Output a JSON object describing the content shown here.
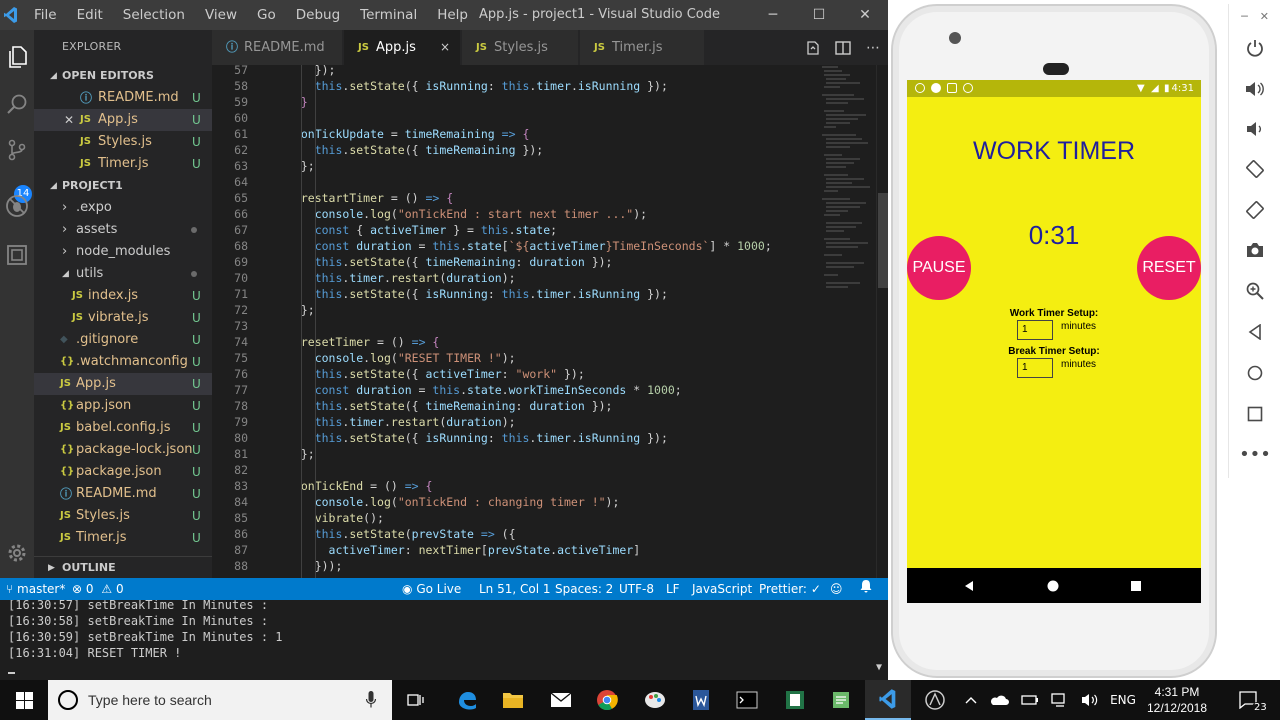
{
  "vscode": {
    "window_title": "App.js - project1 - Visual Studio Code",
    "menu": [
      "File",
      "Edit",
      "Selection",
      "View",
      "Go",
      "Debug",
      "Terminal",
      "Help"
    ],
    "explorer_title": "EXPLORER",
    "scm_badge": "14",
    "open_editors_title": "OPEN EDITORS",
    "open_editors": [
      {
        "name": "README.md",
        "icon": "info-icon",
        "status": "U"
      },
      {
        "name": "App.js",
        "icon": "js-icon",
        "status": "U"
      },
      {
        "name": "Styles.js",
        "icon": "js-icon",
        "status": "U"
      },
      {
        "name": "Timer.js",
        "icon": "js-icon",
        "status": "U"
      }
    ],
    "project_title": "PROJECT1",
    "tree": [
      {
        "name": ".expo",
        "type": "folder",
        "status": ""
      },
      {
        "name": "assets",
        "type": "folder",
        "status": "dot"
      },
      {
        "name": "node_modules",
        "type": "folder",
        "status": ""
      },
      {
        "name": "utils",
        "type": "folder-open",
        "status": "dot"
      },
      {
        "name": "index.js",
        "type": "js",
        "status": "U"
      },
      {
        "name": "vibrate.js",
        "type": "js",
        "status": "U"
      },
      {
        "name": ".gitignore",
        "type": "git",
        "status": "U"
      },
      {
        "name": ".watchmanconfig",
        "type": "json",
        "status": "U"
      },
      {
        "name": "App.js",
        "type": "js",
        "status": "U"
      },
      {
        "name": "app.json",
        "type": "json",
        "status": "U"
      },
      {
        "name": "babel.config.js",
        "type": "js",
        "status": "U"
      },
      {
        "name": "package-lock.json",
        "type": "json",
        "status": "U"
      },
      {
        "name": "package.json",
        "type": "json",
        "status": "U"
      },
      {
        "name": "README.md",
        "type": "info",
        "status": "U"
      },
      {
        "name": "Styles.js",
        "type": "js",
        "status": "U"
      },
      {
        "name": "Timer.js",
        "type": "js",
        "status": "U"
      }
    ],
    "outline_title": "OUTLINE",
    "tabs": [
      {
        "name": "README.md",
        "icon": "info-icon"
      },
      {
        "name": "App.js",
        "icon": "js-icon"
      },
      {
        "name": "Styles.js",
        "icon": "js-icon"
      },
      {
        "name": "Timer.js",
        "icon": "js-icon"
      }
    ],
    "js_badge": "JS",
    "json_badge": "{}",
    "close_glyph": "×",
    "modified_glyph": "U",
    "code_lines": [
      {
        "n": "57",
        "tokens": [
          [
            "op",
            "    });"
          ]
        ]
      },
      {
        "n": "58",
        "tokens": [
          [
            "th",
            "    this"
          ],
          [
            "op",
            "."
          ],
          [
            "fn",
            "setState"
          ],
          [
            "op",
            "({ "
          ],
          [
            "vr",
            "isRunning"
          ],
          [
            "op",
            ": "
          ],
          [
            "th",
            "this"
          ],
          [
            "op",
            "."
          ],
          [
            "vr",
            "timer"
          ],
          [
            "op",
            "."
          ],
          [
            "vr",
            "isRunning"
          ],
          [
            "op",
            " });"
          ]
        ]
      },
      {
        "n": "59",
        "tokens": [
          [
            "kw2",
            "  }"
          ]
        ]
      },
      {
        "n": "60",
        "tokens": []
      },
      {
        "n": "61",
        "tokens": [
          [
            "vr",
            "  onTickUpdate"
          ],
          [
            "op",
            " = "
          ],
          [
            "vr",
            "timeRemaining"
          ],
          [
            "kw",
            " =>"
          ],
          [
            "kw2",
            " {"
          ]
        ]
      },
      {
        "n": "62",
        "tokens": [
          [
            "th",
            "    this"
          ],
          [
            "op",
            "."
          ],
          [
            "fn",
            "setState"
          ],
          [
            "op",
            "({ "
          ],
          [
            "vr",
            "timeRemaining"
          ],
          [
            "op",
            " });"
          ]
        ]
      },
      {
        "n": "63",
        "tokens": [
          [
            "op",
            "  };"
          ]
        ]
      },
      {
        "n": "64",
        "tokens": []
      },
      {
        "n": "65",
        "tokens": [
          [
            "fn",
            "  restartTimer"
          ],
          [
            "op",
            " = () "
          ],
          [
            "kw",
            "=>"
          ],
          [
            "kw2",
            " {"
          ]
        ]
      },
      {
        "n": "66",
        "tokens": [
          [
            "vr",
            "    console"
          ],
          [
            "op",
            "."
          ],
          [
            "fn",
            "log"
          ],
          [
            "op",
            "("
          ],
          [
            "str",
            "\"onTickEnd : start next timer ...\""
          ],
          [
            "op",
            ");"
          ]
        ]
      },
      {
        "n": "67",
        "tokens": [
          [
            "kw",
            "    const"
          ],
          [
            "op",
            " { "
          ],
          [
            "vr",
            "activeTimer"
          ],
          [
            "op",
            " } = "
          ],
          [
            "th",
            "this"
          ],
          [
            "op",
            "."
          ],
          [
            "vr",
            "state"
          ],
          [
            "op",
            ";"
          ]
        ]
      },
      {
        "n": "68",
        "tokens": [
          [
            "kw",
            "    const"
          ],
          [
            "vr",
            " duration"
          ],
          [
            "op",
            " = "
          ],
          [
            "th",
            "this"
          ],
          [
            "op",
            "."
          ],
          [
            "vr",
            "state"
          ],
          [
            "op",
            "["
          ],
          [
            "str",
            "`${"
          ],
          [
            "vr",
            "activeTimer"
          ],
          [
            "str",
            "}TimeInSeconds`"
          ],
          [
            "op",
            "] * "
          ],
          [
            "num",
            "1000"
          ],
          [
            "op",
            ";"
          ]
        ]
      },
      {
        "n": "69",
        "tokens": [
          [
            "th",
            "    this"
          ],
          [
            "op",
            "."
          ],
          [
            "fn",
            "setState"
          ],
          [
            "op",
            "({ "
          ],
          [
            "vr",
            "timeRemaining"
          ],
          [
            "op",
            ": "
          ],
          [
            "vr",
            "duration"
          ],
          [
            "op",
            " });"
          ]
        ]
      },
      {
        "n": "70",
        "tokens": [
          [
            "th",
            "    this"
          ],
          [
            "op",
            "."
          ],
          [
            "vr",
            "timer"
          ],
          [
            "op",
            "."
          ],
          [
            "fn",
            "restart"
          ],
          [
            "op",
            "("
          ],
          [
            "vr",
            "duration"
          ],
          [
            "op",
            ");"
          ]
        ]
      },
      {
        "n": "71",
        "tokens": [
          [
            "th",
            "    this"
          ],
          [
            "op",
            "."
          ],
          [
            "fn",
            "setState"
          ],
          [
            "op",
            "({ "
          ],
          [
            "vr",
            "isRunning"
          ],
          [
            "op",
            ": "
          ],
          [
            "th",
            "this"
          ],
          [
            "op",
            "."
          ],
          [
            "vr",
            "timer"
          ],
          [
            "op",
            "."
          ],
          [
            "vr",
            "isRunning"
          ],
          [
            "op",
            " });"
          ]
        ]
      },
      {
        "n": "72",
        "tokens": [
          [
            "op",
            "  };"
          ]
        ]
      },
      {
        "n": "73",
        "tokens": []
      },
      {
        "n": "74",
        "tokens": [
          [
            "fn",
            "  resetTimer"
          ],
          [
            "op",
            " = () "
          ],
          [
            "kw",
            "=>"
          ],
          [
            "kw2",
            " {"
          ]
        ]
      },
      {
        "n": "75",
        "tokens": [
          [
            "vr",
            "    console"
          ],
          [
            "op",
            "."
          ],
          [
            "fn",
            "log"
          ],
          [
            "op",
            "("
          ],
          [
            "str",
            "\"RESET TIMER !\""
          ],
          [
            "op",
            ");"
          ]
        ]
      },
      {
        "n": "76",
        "tokens": [
          [
            "th",
            "    this"
          ],
          [
            "op",
            "."
          ],
          [
            "fn",
            "setState"
          ],
          [
            "op",
            "({ "
          ],
          [
            "vr",
            "activeTimer"
          ],
          [
            "op",
            ": "
          ],
          [
            "str",
            "\"work\""
          ],
          [
            "op",
            " });"
          ]
        ]
      },
      {
        "n": "77",
        "tokens": [
          [
            "kw",
            "    const"
          ],
          [
            "vr",
            " duration"
          ],
          [
            "op",
            " = "
          ],
          [
            "th",
            "this"
          ],
          [
            "op",
            "."
          ],
          [
            "vr",
            "state"
          ],
          [
            "op",
            "."
          ],
          [
            "vr",
            "workTimeInSeconds"
          ],
          [
            "op",
            " * "
          ],
          [
            "num",
            "1000"
          ],
          [
            "op",
            ";"
          ]
        ]
      },
      {
        "n": "78",
        "tokens": [
          [
            "th",
            "    this"
          ],
          [
            "op",
            "."
          ],
          [
            "fn",
            "setState"
          ],
          [
            "op",
            "({ "
          ],
          [
            "vr",
            "timeRemaining"
          ],
          [
            "op",
            ": "
          ],
          [
            "vr",
            "duration"
          ],
          [
            "op",
            " });"
          ]
        ]
      },
      {
        "n": "79",
        "tokens": [
          [
            "th",
            "    this"
          ],
          [
            "op",
            "."
          ],
          [
            "vr",
            "timer"
          ],
          [
            "op",
            "."
          ],
          [
            "fn",
            "restart"
          ],
          [
            "op",
            "("
          ],
          [
            "vr",
            "duration"
          ],
          [
            "op",
            ");"
          ]
        ]
      },
      {
        "n": "80",
        "tokens": [
          [
            "th",
            "    this"
          ],
          [
            "op",
            "."
          ],
          [
            "fn",
            "setState"
          ],
          [
            "op",
            "({ "
          ],
          [
            "vr",
            "isRunning"
          ],
          [
            "op",
            ": "
          ],
          [
            "th",
            "this"
          ],
          [
            "op",
            "."
          ],
          [
            "vr",
            "timer"
          ],
          [
            "op",
            "."
          ],
          [
            "vr",
            "isRunning"
          ],
          [
            "op",
            " });"
          ]
        ]
      },
      {
        "n": "81",
        "tokens": [
          [
            "op",
            "  };"
          ]
        ]
      },
      {
        "n": "82",
        "tokens": []
      },
      {
        "n": "83",
        "tokens": [
          [
            "fn",
            "  onTickEnd"
          ],
          [
            "op",
            " = () "
          ],
          [
            "kw",
            "=>"
          ],
          [
            "kw2",
            " {"
          ]
        ]
      },
      {
        "n": "84",
        "tokens": [
          [
            "vr",
            "    console"
          ],
          [
            "op",
            "."
          ],
          [
            "fn",
            "log"
          ],
          [
            "op",
            "("
          ],
          [
            "str",
            "\"onTickEnd : changing timer !\""
          ],
          [
            "op",
            ");"
          ]
        ]
      },
      {
        "n": "85",
        "tokens": [
          [
            "fn",
            "    vibrate"
          ],
          [
            "op",
            "();"
          ]
        ]
      },
      {
        "n": "86",
        "tokens": [
          [
            "th",
            "    this"
          ],
          [
            "op",
            "."
          ],
          [
            "fn",
            "setState"
          ],
          [
            "op",
            "("
          ],
          [
            "vr",
            "prevState"
          ],
          [
            "kw",
            " =>"
          ],
          [
            "op",
            " ({"
          ]
        ]
      },
      {
        "n": "87",
        "tokens": [
          [
            "vr",
            "      activeTimer"
          ],
          [
            "op",
            ": "
          ],
          [
            "fn",
            "nextTimer"
          ],
          [
            "op",
            "["
          ],
          [
            "vr",
            "prevState"
          ],
          [
            "op",
            "."
          ],
          [
            "vr",
            "activeTimer"
          ],
          [
            "op",
            "]"
          ]
        ]
      },
      {
        "n": "88",
        "tokens": [
          [
            "op",
            "    }));"
          ]
        ]
      }
    ],
    "status": {
      "branch": "master*",
      "errors": "0",
      "warnings": "0",
      "go_live": "Go Live",
      "position": "Ln 51, Col 1",
      "spaces": "Spaces: 2",
      "encoding": "UTF-8",
      "eol": "LF",
      "language": "JavaScript",
      "prettier": "Prettier:"
    }
  },
  "terminal": {
    "lines": [
      "[16:30:57] setBreakTime In Minutes :",
      "[16:30:58] setBreakTime In Minutes :",
      "[16:30:59] setBreakTime In Minutes : 1",
      "[16:31:04] RESET TIMER !"
    ]
  },
  "phone": {
    "status_time": "4:31",
    "title": "WORK TIMER",
    "time_display": "0:31",
    "pause_label": "PAUSE",
    "reset_label": "RESET",
    "work_setup_label": "Work Timer Setup:",
    "work_value": "1",
    "break_setup_label": "Break Timer Setup:",
    "break_value": "1",
    "unit": "minutes",
    "colors": {
      "background": "#f4ee11",
      "title": "#1f1f9e",
      "button": "#e91e63"
    }
  },
  "taskbar": {
    "search_placeholder": "Type here to search",
    "lang": "ENG",
    "time": "4:31 PM",
    "date": "12/12/2018",
    "notifications": "23"
  }
}
